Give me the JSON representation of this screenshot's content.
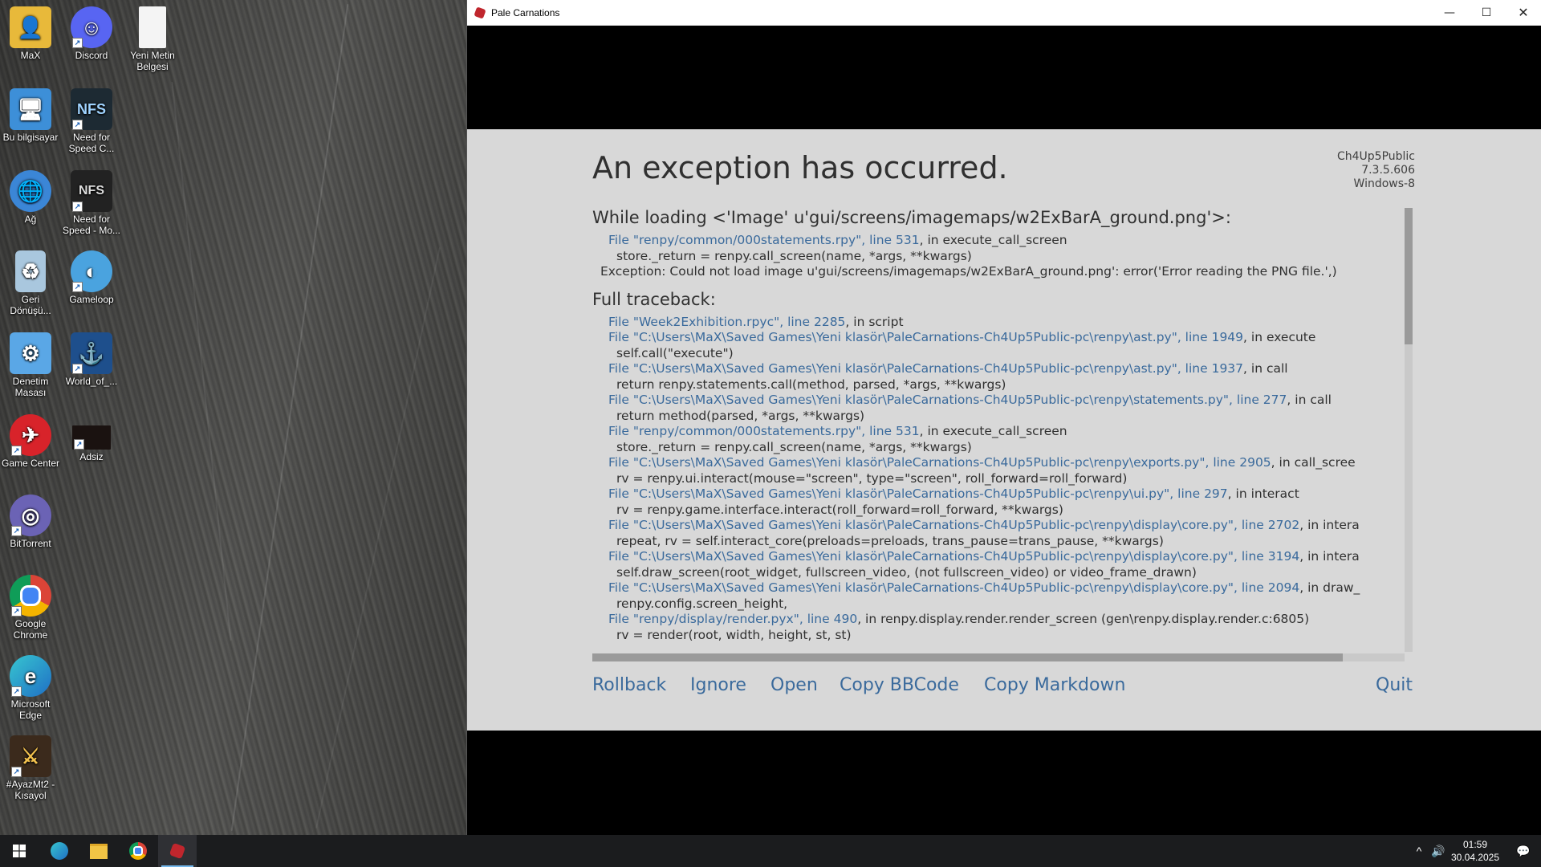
{
  "desktop": {
    "icons": [
      {
        "label": "MaX",
        "icon": "user-folder-icon"
      },
      {
        "label": "Discord",
        "icon": "discord-icon"
      },
      {
        "label": "Yeni Metin Belgesi",
        "icon": "text-document-icon"
      },
      {
        "label": "Bu bilgisayar",
        "icon": "computer-icon"
      },
      {
        "label": "Need for Speed C...",
        "icon": "nfs-carbon-icon"
      },
      {
        "label": "Ağ",
        "icon": "network-icon"
      },
      {
        "label": "Need for Speed - Mo...",
        "icon": "nfs-mostwanted-icon"
      },
      {
        "label": "Geri Dönüşü...",
        "icon": "recycle-bin-icon"
      },
      {
        "label": "Gameloop",
        "icon": "gameloop-icon"
      },
      {
        "label": "Denetim Masası",
        "icon": "control-panel-icon"
      },
      {
        "label": "World_of_...",
        "icon": "world-of-warships-icon"
      },
      {
        "label": "Game Center",
        "icon": "game-center-icon"
      },
      {
        "label": "Adsiz",
        "icon": "video-thumbnail-icon"
      },
      {
        "label": "BitTorrent",
        "icon": "bittorrent-icon"
      },
      {
        "label": "Google Chrome",
        "icon": "chrome-icon"
      },
      {
        "label": "Microsoft Edge",
        "icon": "edge-icon"
      },
      {
        "label": "#AyazMt2 - Kısayol",
        "icon": "game-shortcut-icon"
      }
    ]
  },
  "window": {
    "title": "Pale Carnations",
    "controls": {
      "minimize": "—",
      "maximize": "☐",
      "close": "✕"
    }
  },
  "error": {
    "heading": "An exception has occurred.",
    "version": [
      "Ch4Up5Public",
      "7.3.5.606",
      "Windows-8"
    ],
    "loading_header": "While loading <'Image' u'gui/screens/imagemaps/w2ExBarA_ground.png'>:",
    "loading_lines": [
      {
        "kind": "file",
        "link": "File \"renpy/common/000statements.rpy\", line 531",
        "rest": ", in execute_call_screen"
      },
      {
        "kind": "code",
        "text": "store._return = renpy.call_screen(name, *args, **kwargs)"
      },
      {
        "kind": "exc",
        "text": "Exception: Could not load image u'gui/screens/imagemaps/w2ExBarA_ground.png': error('Error reading the PNG file.',)"
      }
    ],
    "full_header": "Full traceback:",
    "full_lines": [
      {
        "kind": "file",
        "link": "File \"Week2Exhibition.rpyc\", line 2285",
        "rest": ", in script"
      },
      {
        "kind": "file",
        "link": "File \"C:\\Users\\MaX\\Saved Games\\Yeni klasör\\PaleCarnations-Ch4Up5Public-pc\\renpy\\ast.py\", line 1949",
        "rest": ", in execute"
      },
      {
        "kind": "code",
        "text": "self.call(\"execute\")"
      },
      {
        "kind": "file",
        "link": "File \"C:\\Users\\MaX\\Saved Games\\Yeni klasör\\PaleCarnations-Ch4Up5Public-pc\\renpy\\ast.py\", line 1937",
        "rest": ", in call"
      },
      {
        "kind": "code",
        "text": "return renpy.statements.call(method, parsed, *args, **kwargs)"
      },
      {
        "kind": "file",
        "link": "File \"C:\\Users\\MaX\\Saved Games\\Yeni klasör\\PaleCarnations-Ch4Up5Public-pc\\renpy\\statements.py\", line 277",
        "rest": ", in call"
      },
      {
        "kind": "code",
        "text": "return method(parsed, *args, **kwargs)"
      },
      {
        "kind": "file",
        "link": "File \"renpy/common/000statements.rpy\", line 531",
        "rest": ", in execute_call_screen"
      },
      {
        "kind": "code",
        "text": "store._return = renpy.call_screen(name, *args, **kwargs)"
      },
      {
        "kind": "file",
        "link": "File \"C:\\Users\\MaX\\Saved Games\\Yeni klasör\\PaleCarnations-Ch4Up5Public-pc\\renpy\\exports.py\", line 2905",
        "rest": ", in call_scree"
      },
      {
        "kind": "code",
        "text": "rv = renpy.ui.interact(mouse=\"screen\", type=\"screen\", roll_forward=roll_forward)"
      },
      {
        "kind": "file",
        "link": "File \"C:\\Users\\MaX\\Saved Games\\Yeni klasör\\PaleCarnations-Ch4Up5Public-pc\\renpy\\ui.py\", line 297",
        "rest": ", in interact"
      },
      {
        "kind": "code",
        "text": "rv = renpy.game.interface.interact(roll_forward=roll_forward, **kwargs)"
      },
      {
        "kind": "file",
        "link": "File \"C:\\Users\\MaX\\Saved Games\\Yeni klasör\\PaleCarnations-Ch4Up5Public-pc\\renpy\\display\\core.py\", line 2702",
        "rest": ", in intera"
      },
      {
        "kind": "code",
        "text": "repeat, rv = self.interact_core(preloads=preloads, trans_pause=trans_pause, **kwargs)"
      },
      {
        "kind": "file",
        "link": "File \"C:\\Users\\MaX\\Saved Games\\Yeni klasör\\PaleCarnations-Ch4Up5Public-pc\\renpy\\display\\core.py\", line 3194",
        "rest": ", in intera"
      },
      {
        "kind": "code",
        "text": "self.draw_screen(root_widget, fullscreen_video, (not fullscreen_video) or video_frame_drawn)"
      },
      {
        "kind": "file",
        "link": "File \"C:\\Users\\MaX\\Saved Games\\Yeni klasör\\PaleCarnations-Ch4Up5Public-pc\\renpy\\display\\core.py\", line 2094",
        "rest": ", in draw_"
      },
      {
        "kind": "code",
        "text": "renpy.config.screen_height,"
      },
      {
        "kind": "file",
        "link": "File \"renpy/display/render.pyx\", line 490",
        "rest": ", in renpy.display.render.render_screen (gen\\renpy.display.render.c:6805)"
      },
      {
        "kind": "code",
        "text": "rv = render(root, width, height, st, st)"
      }
    ],
    "actions": {
      "rollback": "Rollback",
      "ignore": "Ignore",
      "open": "Open",
      "copy_bbcode": "Copy BBCode",
      "copy_markdown": "Copy Markdown",
      "quit": "Quit"
    }
  },
  "taskbar": {
    "apps": [
      {
        "name": "start-button",
        "icon": "windows-logo-icon"
      },
      {
        "name": "taskbar-edge",
        "icon": "edge-icon"
      },
      {
        "name": "taskbar-file-explorer",
        "icon": "folder-icon"
      },
      {
        "name": "taskbar-chrome",
        "icon": "chrome-icon"
      },
      {
        "name": "taskbar-pale-carnations",
        "icon": "pale-carnations-icon"
      }
    ],
    "tray": {
      "chevron": "^",
      "volume": "🔊",
      "notifications": "💬"
    },
    "clock": {
      "time": "01:59",
      "date": "30.04.2025"
    }
  }
}
